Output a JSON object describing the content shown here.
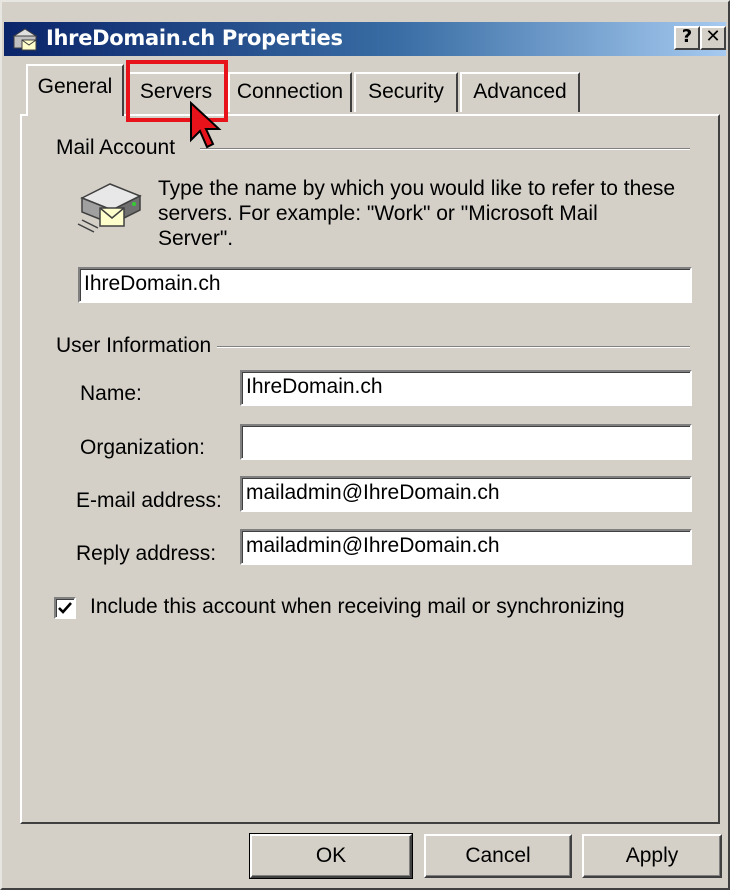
{
  "window": {
    "title": "IhreDomain.ch Properties",
    "help_label": "?",
    "close_label": "✕"
  },
  "tabs": [
    {
      "label": "General",
      "active": true
    },
    {
      "label": "Servers",
      "active": false
    },
    {
      "label": "Connection",
      "active": false
    },
    {
      "label": "Security",
      "active": false
    },
    {
      "label": "Advanced",
      "active": false
    }
  ],
  "mail_account": {
    "group_label": "Mail Account",
    "hint_line1": "Type the name by which you would like to refer to these",
    "hint_line2": "servers.  For example: \"Work\" or \"Microsoft Mail",
    "hint_line3": "Server\".",
    "account_name": "IhreDomain.ch"
  },
  "user_info": {
    "group_label": "User Information",
    "name_label": "Name:",
    "name_value": "IhreDomain.ch",
    "org_label": "Organization:",
    "org_value": "",
    "email_label": "E-mail address:",
    "email_value": "mailadmin@IhreDomain.ch",
    "reply_label": "Reply address:",
    "reply_value": "mailadmin@IhreDomain.ch"
  },
  "include_account": {
    "label": "Include this account when receiving mail or synchronizing",
    "checked": true
  },
  "buttons": {
    "ok": "OK",
    "cancel": "Cancel",
    "apply": "Apply"
  },
  "colors": {
    "highlight": "#e8121b",
    "titlebar_start": "#0a246a",
    "titlebar_end": "#a6caf0",
    "face": "#d4d0c8"
  }
}
